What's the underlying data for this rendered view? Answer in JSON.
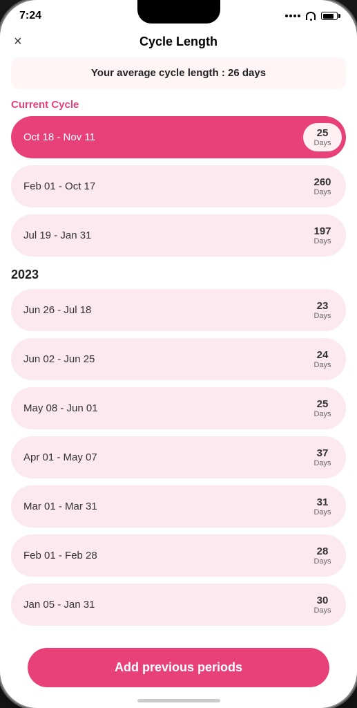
{
  "status": {
    "time": "7:24"
  },
  "header": {
    "title": "Cycle Length",
    "close_label": "×"
  },
  "average_banner": {
    "text": "Your average cycle length : 26 days"
  },
  "current_section_label": "Current Cycle",
  "cycles_current": [
    {
      "date": "Oct 18 - Nov 11",
      "days_num": "25",
      "days_label": "Days"
    }
  ],
  "cycles_recent": [
    {
      "date": "Feb 01 - Oct 17",
      "days_num": "260",
      "days_label": "Days"
    },
    {
      "date": "Jul 19 - Jan 31",
      "days_num": "197",
      "days_label": "Days"
    }
  ],
  "year_2023": "2023",
  "cycles_2023": [
    {
      "date": "Jun 26 - Jul 18",
      "days_num": "23",
      "days_label": "Days"
    },
    {
      "date": "Jun 02 - Jun 25",
      "days_num": "24",
      "days_label": "Days"
    },
    {
      "date": "May 08 - Jun 01",
      "days_num": "25",
      "days_label": "Days"
    },
    {
      "date": "Apr 01 - May 07",
      "days_num": "37",
      "days_label": "Days"
    },
    {
      "date": "Mar 01 - Mar 31",
      "days_num": "31",
      "days_label": "Days"
    },
    {
      "date": "Feb 01 - Feb 28",
      "days_num": "28",
      "days_label": "Days"
    },
    {
      "date": "Jan 05 - Jan 31",
      "days_num": "30",
      "days_label": "Days"
    }
  ],
  "add_button_label": "Add previous periods"
}
